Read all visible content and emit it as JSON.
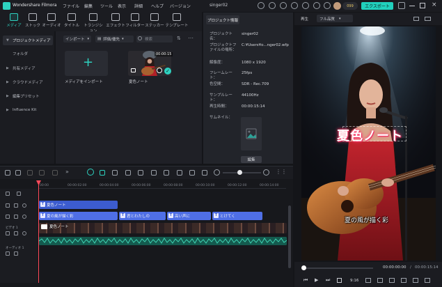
{
  "titlebar": {
    "app_name": "Wondershare Filmora",
    "menu": [
      "ファイル",
      "編集",
      "ツール",
      "表示",
      "詳細",
      "ヘルプ",
      "バージョン"
    ],
    "project_name": "singer02",
    "coins": "099",
    "export_label": "エクスポート"
  },
  "toolbar": {
    "tools": [
      {
        "label": "メディア",
        "icon": "media-icon"
      },
      {
        "label": "ストック",
        "icon": "stock-icon"
      },
      {
        "label": "オーディオ",
        "icon": "audio-icon"
      },
      {
        "label": "タイトル",
        "icon": "title-icon"
      },
      {
        "label": "トランジション",
        "icon": "transition-icon"
      },
      {
        "label": "エフェクト",
        "icon": "effect-icon"
      },
      {
        "label": "フィルター",
        "icon": "filter-icon"
      },
      {
        "label": "ステッカー",
        "icon": "sticker-icon"
      },
      {
        "label": "テンプレート",
        "icon": "template-icon"
      }
    ]
  },
  "leftnav": {
    "items": [
      "プロジェクトメディア",
      "フォルダ",
      "共有メディア",
      "クラウドメディア",
      "編集プリセット",
      "Influence Kit"
    ]
  },
  "media": {
    "import_dropdown": "インポート",
    "filter_dropdown": "評価/優先",
    "search_placeholder": "検索",
    "import_tile_label": "メディアをインポート",
    "clip_label": "夏色ノート",
    "clip_duration": "00:00:15"
  },
  "info": {
    "tab": "プロジェクト情報",
    "rows": [
      {
        "label": "プロジェクト名：",
        "value": "singer02"
      },
      {
        "label": "プロジェクトファイルの場所：",
        "value": "C:¥Users¥o...nger02.wfp"
      },
      {
        "label": "解像度：",
        "value": "1080 x 1920"
      },
      {
        "label": "フレームレート：",
        "value": "25fps"
      },
      {
        "label": "色空間：",
        "value": "SDR - Rec.709"
      },
      {
        "label": "サンプルレート：",
        "value": "44100Hz"
      },
      {
        "label": "再生時間：",
        "value": "00:00:15:14"
      },
      {
        "label": "サムネイル：",
        "value": ""
      }
    ],
    "edit_button": "編集"
  },
  "preview": {
    "label": "再生",
    "quality": "フル品質",
    "title_overlay": "夏色ノート",
    "subtitle_overlay": "夏の風が描く彩",
    "timecode_current": "00:00:00:00",
    "timecode_total": "00:00:15:14",
    "speed": "9:16",
    "progress": 0.0
  },
  "timeline": {
    "ruler": [
      "00:00",
      "00:00:02:00",
      "00:00:04:00",
      "00:00:06:00",
      "00:00:08:00",
      "00:00:10:00",
      "00:00:12:00",
      "00:00:14:00"
    ],
    "tracks": {
      "title_clip": "夏色ノート",
      "subtitle_clips": [
        "夏の風が描く彩",
        "君とわたしの",
        "高い声に",
        "とけてく"
      ],
      "video_clip": "夏色ノート",
      "video_track_label": "ビデオ 1",
      "audio_track_label": "オーディオ 1"
    }
  },
  "colors": {
    "accent": "#2ed2c0",
    "title_clip": "#3c5ccf",
    "subtitle_clip": "#4f6fe6",
    "audio_clip": "#145a4e",
    "playhead": "#ff4a5a"
  }
}
